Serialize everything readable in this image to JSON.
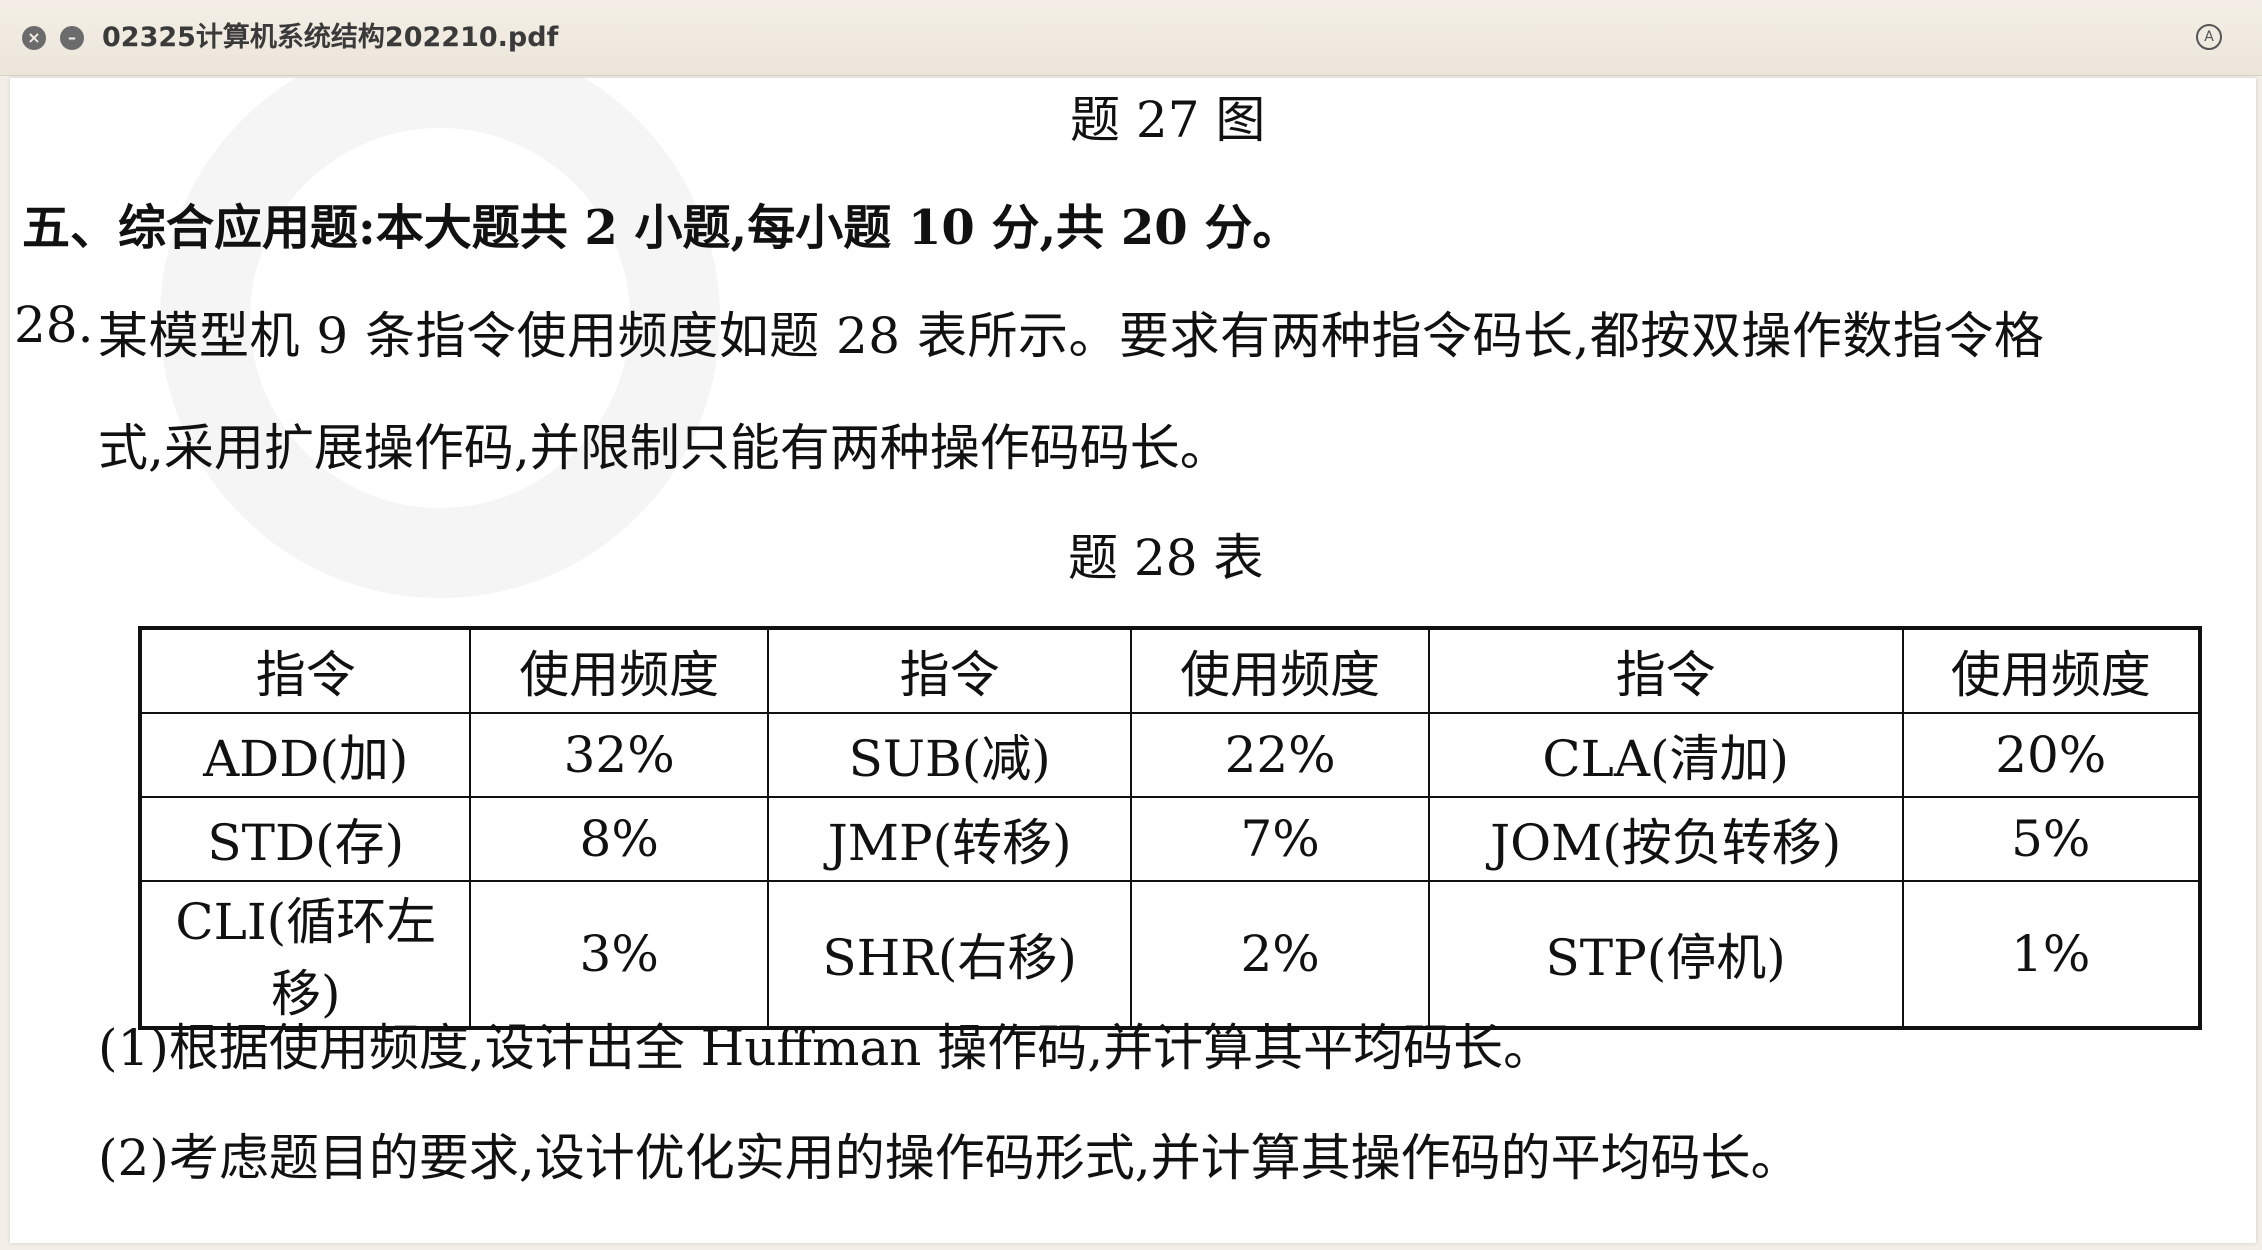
{
  "window": {
    "title": "02325计算机系统结构202210.pdf",
    "close_icon": "close-icon",
    "minimize_icon": "minimize-icon",
    "reader_icon": "reader-mode-icon"
  },
  "document": {
    "figure_caption": "题 27 图",
    "section_heading": "五、综合应用题:本大题共 2 小题,每小题 10 分,共 20 分。",
    "question_number": "28.",
    "question_line1": "某模型机 9 条指令使用频度如题 28 表所示。要求有两种指令码长,都按双操作数指令格",
    "question_line2": "式,采用扩展操作码,并限制只能有两种操作码码长。",
    "table_caption": "题 28 表",
    "table": {
      "headers": [
        "指令",
        "使用频度",
        "指令",
        "使用频度",
        "指令",
        "使用频度"
      ],
      "rows": [
        [
          "ADD(加)",
          "32%",
          "SUB(减)",
          "22%",
          "CLA(清加)",
          "20%"
        ],
        [
          "STD(存)",
          "8%",
          "JMP(转移)",
          "7%",
          "JOM(按负转移)",
          "5%"
        ],
        [
          "CLI(循环左移)",
          "3%",
          "SHR(右移)",
          "2%",
          "STP(停机)",
          "1%"
        ]
      ]
    },
    "sub_question_1": "(1)根据使用频度,设计出全 Huffman 操作码,并计算其平均码长。",
    "sub_question_2": "(2)考虑题目的要求,设计优化实用的操作码形式,并计算其操作码的平均码长。"
  }
}
